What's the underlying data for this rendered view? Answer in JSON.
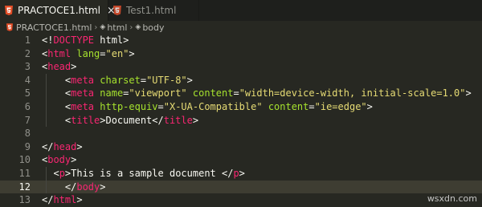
{
  "tabs": [
    {
      "label": "PRACTOCE1.html",
      "active": true,
      "close": "×"
    },
    {
      "label": "Test1.html",
      "active": false
    }
  ],
  "breadcrumb": [
    "PRACTOCE1.html",
    "html",
    "body"
  ],
  "lines": [
    {
      "n": "1",
      "tokens": [
        [
          "t",
          "<!"
        ],
        [
          "tag",
          "DOCTYPE"
        ],
        [
          "t",
          " html>"
        ]
      ]
    },
    {
      "n": "2",
      "tokens": [
        [
          "t",
          "<"
        ],
        [
          "tag",
          "html"
        ],
        [
          "t",
          " "
        ],
        [
          "attr",
          "lang"
        ],
        [
          "t",
          "="
        ],
        [
          "str",
          "\"en\""
        ],
        [
          "t",
          ">"
        ]
      ]
    },
    {
      "n": "3",
      "tokens": [
        [
          "t",
          "<"
        ],
        [
          "tag",
          "head"
        ],
        [
          "t",
          ">"
        ]
      ]
    },
    {
      "n": "4",
      "tokens": [
        [
          "t",
          "    <"
        ],
        [
          "tag",
          "meta"
        ],
        [
          "t",
          " "
        ],
        [
          "attr",
          "charset"
        ],
        [
          "t",
          "="
        ],
        [
          "str",
          "\"UTF-8\""
        ],
        [
          "t",
          ">"
        ]
      ]
    },
    {
      "n": "5",
      "tokens": [
        [
          "t",
          "    <"
        ],
        [
          "tag",
          "meta"
        ],
        [
          "t",
          " "
        ],
        [
          "attr",
          "name"
        ],
        [
          "t",
          "="
        ],
        [
          "str",
          "\"viewport\""
        ],
        [
          "t",
          " "
        ],
        [
          "attr",
          "content"
        ],
        [
          "t",
          "="
        ],
        [
          "str",
          "\"width=device-width, initial-scale=1.0\""
        ],
        [
          "t",
          ">"
        ]
      ]
    },
    {
      "n": "6",
      "tokens": [
        [
          "t",
          "    <"
        ],
        [
          "tag",
          "meta"
        ],
        [
          "t",
          " "
        ],
        [
          "attr",
          "http-equiv"
        ],
        [
          "t",
          "="
        ],
        [
          "str",
          "\"X-UA-Compatible\""
        ],
        [
          "t",
          " "
        ],
        [
          "attr",
          "content"
        ],
        [
          "t",
          "="
        ],
        [
          "str",
          "\"ie=edge\""
        ],
        [
          "t",
          ">"
        ]
      ]
    },
    {
      "n": "7",
      "tokens": [
        [
          "t",
          "    <"
        ],
        [
          "tag",
          "title"
        ],
        [
          "t",
          ">Document</"
        ],
        [
          "tag",
          "title"
        ],
        [
          "t",
          ">"
        ]
      ]
    },
    {
      "n": "8",
      "tokens": []
    },
    {
      "n": "9",
      "tokens": [
        [
          "t",
          "</"
        ],
        [
          "tag",
          "head"
        ],
        [
          "t",
          ">"
        ]
      ]
    },
    {
      "n": "10",
      "tokens": [
        [
          "t",
          "<"
        ],
        [
          "tag",
          "body"
        ],
        [
          "t",
          ">"
        ]
      ]
    },
    {
      "n": "11",
      "tokens": [
        [
          "t",
          "  <"
        ],
        [
          "tag",
          "p"
        ],
        [
          "t",
          ">This is a sample document </"
        ],
        [
          "tag",
          "p"
        ],
        [
          "t",
          ">"
        ]
      ]
    },
    {
      "n": "12",
      "tokens": [
        [
          "t",
          "    </"
        ],
        [
          "tag",
          "body"
        ],
        [
          "t",
          ">"
        ]
      ],
      "current": true
    },
    {
      "n": "13",
      "tokens": [
        [
          "t",
          "</"
        ],
        [
          "tag",
          "html"
        ],
        [
          "t",
          ">"
        ]
      ]
    }
  ],
  "watermark": "wsxdn.com",
  "colors": {
    "background": "#272822",
    "tag": "#f92672",
    "attribute": "#a6e22e",
    "string": "#e6db74",
    "html_icon": "#e44d26"
  }
}
